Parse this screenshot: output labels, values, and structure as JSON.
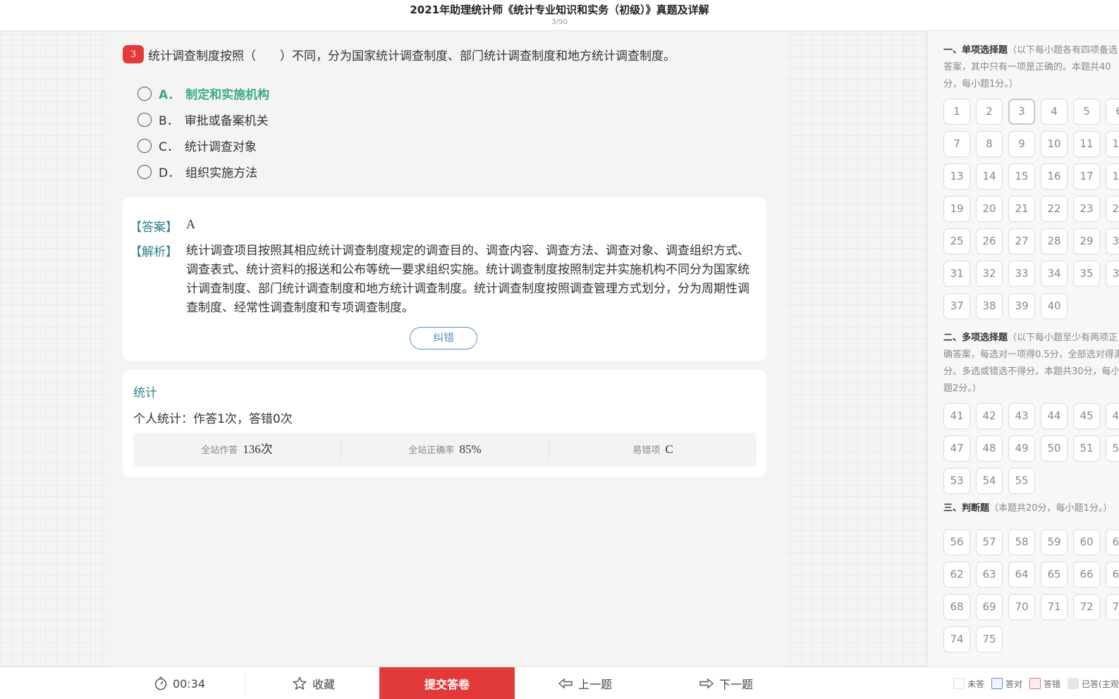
{
  "header": {
    "title": "2021年助理统计师《统计专业知识和实务（初级）》真题及详解",
    "progress": "3/90"
  },
  "question": {
    "number": "3",
    "text": "统计调查制度按照（　　）不同，分为国家统计调查制度、部门统计调查制度和地方统计调查制度。",
    "options": [
      {
        "letter": "A．",
        "text": "制定和实施机构",
        "correct": true
      },
      {
        "letter": "B．",
        "text": "审批或备案机关",
        "correct": false
      },
      {
        "letter": "C．",
        "text": "统计调查对象",
        "correct": false
      },
      {
        "letter": "D．",
        "text": "组织实施方法",
        "correct": false
      }
    ]
  },
  "answer": {
    "answer_label": "【答案】",
    "answer_value": "A",
    "explain_label": "【解析】",
    "explain_text": "统计调查项目按照其相应统计调查制度规定的调查目的、调查内容、调查方法、调查对象、调查组织方式、调查表式、统计资料的报送和公布等统一要求组织实施。统计调查制度按照制定并实施机构不同分为国家统计调查制度、部门统计调查制度和地方统计调查制度。统计调查制度按照调查管理方式划分，分为周期性调查制度、经常性调查制度和专项调查制度。",
    "report_label": "纠错"
  },
  "stats": {
    "title": "统计",
    "personal": "个人统计：作答1次，答错0次",
    "site_attempts_label": "全站作答",
    "site_attempts_value": "136次",
    "site_accuracy_label": "全站正确率",
    "site_accuracy_value": "85%",
    "common_wrong_label": "易错项",
    "common_wrong_value": "C"
  },
  "sidebar": {
    "section1": {
      "name": "一、单项选择题",
      "desc": "（以下每小题各有四项备选答案，其中只有一项是正确的。本题共40分，每小题1分。）"
    },
    "section2": {
      "name": "二、多项选择题",
      "desc": "（以下每小题至少有两项正确答案，每选对一项得0.5分，全部选对得满分。多选或错选不得分。本题共30分，每小题2分。）"
    },
    "section3": {
      "name": "三、判断题",
      "desc": "（本题共20分，每小题1分。）"
    },
    "current_question": 3
  },
  "bottom": {
    "timer": "00:34",
    "favorite": "收藏",
    "submit": "提交答卷",
    "prev": "上一题",
    "next": "下一题",
    "legend_unanswered": "未答",
    "legend_correct": "答对",
    "legend_wrong": "答错",
    "legend_subjective": "已答(主观"
  },
  "colors": {
    "accent_red": "#e23a3a",
    "correct_green": "#3aa98a",
    "label_teal": "#2e7f8c",
    "link_blue": "#5b8fc8"
  }
}
